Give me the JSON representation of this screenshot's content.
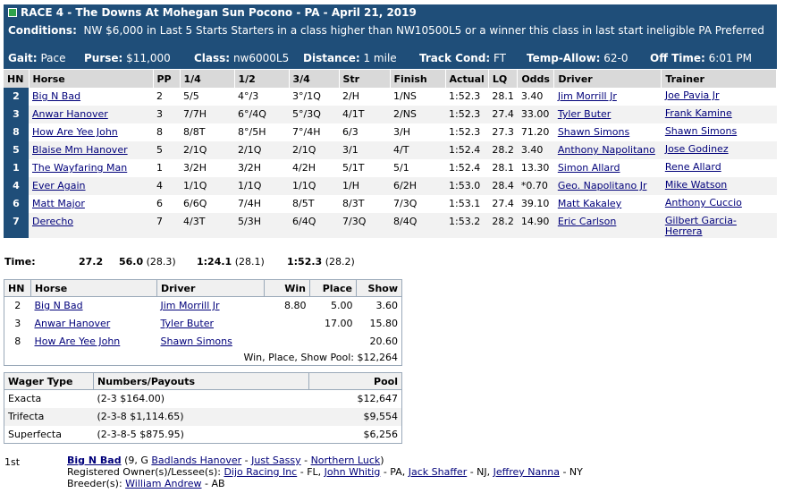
{
  "header": {
    "title": "RACE 4 - The Downs At Mohegan Sun Pocono - PA - April 21, 2019",
    "conditions_label": "Conditions:",
    "conditions_text": "NW $6,000 in Last 5 Starts Starters in a class higher than NW10500L5 or a winner this class in last start ineligible PA Preferred",
    "gait_label": "Gait:",
    "gait": "Pace",
    "purse_label": "Purse:",
    "purse": "$11,000",
    "class_label": "Class:",
    "class": "nw6000L5",
    "distance_label": "Distance:",
    "distance": "1 mile",
    "track_label": "Track Cond:",
    "track": "FT",
    "temp_label": "Temp-Allow:",
    "temp": "62-0",
    "off_label": "Off Time:",
    "off": "6:01 PM"
  },
  "results": {
    "columns": [
      "HN",
      "Horse",
      "PP",
      "1/4",
      "1/2",
      "3/4",
      "Str",
      "Finish",
      "Actual",
      "LQ",
      "Odds",
      "Driver",
      "Trainer"
    ],
    "rows": [
      {
        "hn": "2",
        "horse": "Big N Bad",
        "pp": "2",
        "q1": "5/5",
        "q2": "4°/3",
        "q3": "3°/1Q",
        "str": "2/H",
        "fin": "1/NS",
        "actual": "1:52.3",
        "lq": "28.1",
        "odds": "3.40",
        "driver": "Jim Morrill Jr",
        "trainer": "Joe Pavia Jr"
      },
      {
        "hn": "3",
        "horse": "Anwar Hanover",
        "pp": "3",
        "q1": "7/7H",
        "q2": "6°/4Q",
        "q3": "5°/3Q",
        "str": "4/1T",
        "fin": "2/NS",
        "actual": "1:52.3",
        "lq": "27.4",
        "odds": "33.00",
        "driver": "Tyler Buter",
        "trainer": "Frank Kamine"
      },
      {
        "hn": "8",
        "horse": "How Are Yee John",
        "pp": "8",
        "q1": "8/8T",
        "q2": "8°/5H",
        "q3": "7°/4H",
        "str": "6/3",
        "fin": "3/H",
        "actual": "1:52.3",
        "lq": "27.3",
        "odds": "71.20",
        "driver": "Shawn Simons",
        "trainer": "Shawn Simons"
      },
      {
        "hn": "5",
        "horse": "Blaise Mm Hanover",
        "pp": "5",
        "q1": "2/1Q",
        "q2": "2/1Q",
        "q3": "2/1Q",
        "str": "3/1",
        "fin": "4/T",
        "actual": "1:52.4",
        "lq": "28.2",
        "odds": "3.40",
        "driver": "Anthony Napolitano",
        "trainer": "Jose Godinez"
      },
      {
        "hn": "1",
        "horse": "The Wayfaring Man",
        "pp": "1",
        "q1": "3/2H",
        "q2": "3/2H",
        "q3": "4/2H",
        "str": "5/1T",
        "fin": "5/1",
        "actual": "1:52.4",
        "lq": "28.1",
        "odds": "13.30",
        "driver": "Simon Allard",
        "trainer": "Rene Allard"
      },
      {
        "hn": "4",
        "horse": "Ever Again",
        "pp": "4",
        "q1": "1/1Q",
        "q2": "1/1Q",
        "q3": "1/1Q",
        "str": "1/H",
        "fin": "6/2H",
        "actual": "1:53.0",
        "lq": "28.4",
        "odds": "*0.70",
        "driver": "Geo. Napolitano Jr",
        "trainer": "Mike Watson"
      },
      {
        "hn": "6",
        "horse": "Matt Major",
        "pp": "6",
        "q1": "6/6Q",
        "q2": "7/4H",
        "q3": "8/5T",
        "str": "8/3T",
        "fin": "7/3Q",
        "actual": "1:53.1",
        "lq": "27.4",
        "odds": "39.10",
        "driver": "Matt Kakaley",
        "trainer": "Anthony Cuccio"
      },
      {
        "hn": "7",
        "horse": "Derecho",
        "pp": "7",
        "q1": "4/3T",
        "q2": "5/3H",
        "q3": "6/4Q",
        "str": "7/3Q",
        "fin": "8/4Q",
        "actual": "1:53.2",
        "lq": "28.2",
        "odds": "14.90",
        "driver": "Eric Carlson",
        "trainer": "Gilbert Garcia-Herrera"
      }
    ]
  },
  "times": {
    "label": "Time:",
    "q1": "27.2",
    "q2": "56.0",
    "q2_split": "(28.3)",
    "q3": "1:24.1",
    "q3_split": "(28.1)",
    "final": "1:52.3",
    "final_split": "(28.2)"
  },
  "payouts": {
    "columns": [
      "HN",
      "Horse",
      "Driver",
      "Win",
      "Place",
      "Show"
    ],
    "rows": [
      {
        "hn": "2",
        "horse": "Big N Bad",
        "driver": "Jim Morrill Jr",
        "win": "8.80",
        "place": "5.00",
        "show": "3.60"
      },
      {
        "hn": "3",
        "horse": "Anwar Hanover",
        "driver": "Tyler Buter",
        "win": "",
        "place": "17.00",
        "show": "15.80"
      },
      {
        "hn": "8",
        "horse": "How Are Yee John",
        "driver": "Shawn Simons",
        "win": "",
        "place": "",
        "show": "20.60"
      }
    ],
    "pool": "Win, Place, Show Pool: $12,264"
  },
  "wagers": {
    "columns": [
      "Wager Type",
      "Numbers/Payouts",
      "Pool"
    ],
    "rows": [
      {
        "type": "Exacta",
        "numbers": "(2-3 $164.00)",
        "pool": "$12,647"
      },
      {
        "type": "Trifecta",
        "numbers": "(2-3-8 $1,114.65)",
        "pool": "$9,554"
      },
      {
        "type": "Superfecta",
        "numbers": "(2-3-8-5 $875.95)",
        "pool": "$6,256"
      }
    ]
  },
  "detail": {
    "position": "1st",
    "horse": "Big N Bad",
    "age_sex": "(9, G",
    "sire": "Badlands Hanover",
    "dash1": "-",
    "dam": "Just Sassy",
    "dash2": "-",
    "damsire": "Northern Luck",
    "close": ")",
    "owners_label": "Registered Owner(s)/Lessee(s):",
    "owner1": "Dijo Racing Inc",
    "owner1_loc": "- FL,",
    "owner2": "John Whitig",
    "owner2_loc": "- PA,",
    "owner3": "Jack Shaffer",
    "owner3_loc": "- NJ,",
    "owner4": "Jeffrey Nanna",
    "owner4_loc": "- NY",
    "breeder_label": "Breeder(s):",
    "breeder": "William Andrew",
    "breeder_loc": "- AB"
  }
}
